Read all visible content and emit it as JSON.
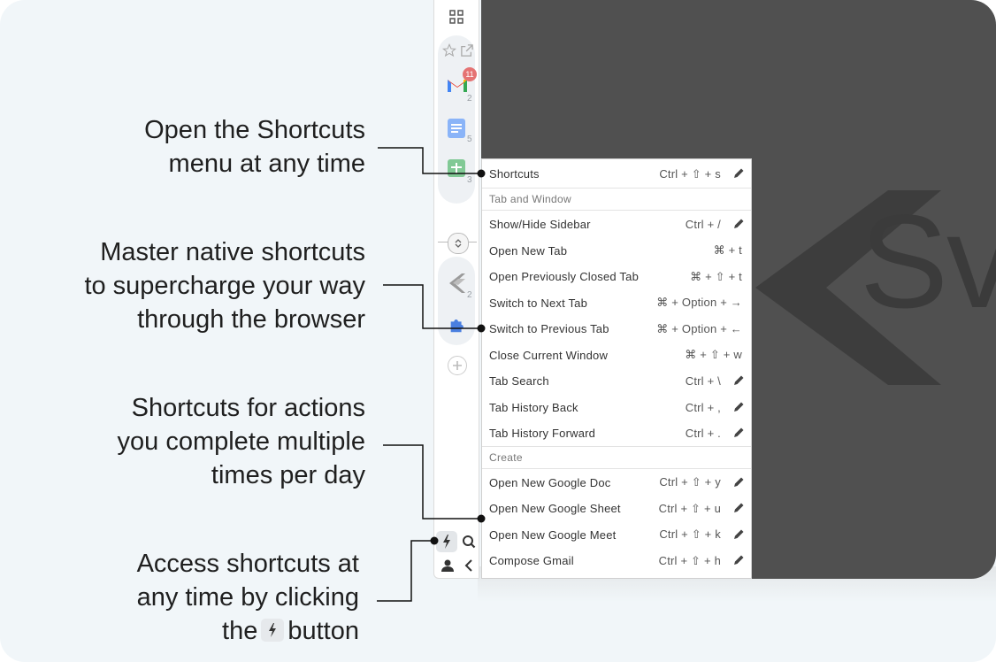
{
  "callouts": [
    {
      "lines": [
        "Open the Shortcuts",
        "menu at any time"
      ]
    },
    {
      "lines": [
        "Master native shortcuts",
        "to supercharge your way",
        "through the browser"
      ]
    },
    {
      "lines": [
        "Shortcuts for actions",
        "you complete multiple",
        "times per day"
      ]
    },
    {
      "lines_before": [
        "Access shortcuts at",
        "any time by clicking"
      ],
      "last_before": "the",
      "last_after": "button"
    }
  ],
  "sidebar": {
    "gmail_badge": "11",
    "gmail_count": "2",
    "docs_count": "5",
    "sheets_count": "3",
    "shift_count": "2"
  },
  "watermark": "Sv",
  "panel": {
    "header": {
      "name": "Shortcuts",
      "keys": "Ctrl + ⇧ + s"
    },
    "sections": [
      {
        "title": "Tab and Window",
        "rows": [
          {
            "name": "Show/Hide Sidebar",
            "keys": "Ctrl + /",
            "editable": true
          },
          {
            "name": "Open New Tab",
            "keys": "⌘ + t",
            "editable": false
          },
          {
            "name": "Open Previously Closed Tab",
            "keys": "⌘ + ⇧ + t",
            "editable": false
          },
          {
            "name": "Switch to Next Tab",
            "keys": "⌘ + Option + →",
            "editable": false
          },
          {
            "name": "Switch to Previous Tab",
            "keys": "⌘ + Option + ←",
            "editable": false
          },
          {
            "name": "Close Current Window",
            "keys": "⌘ + ⇧ + w",
            "editable": false
          },
          {
            "name": "Tab Search",
            "keys": "Ctrl + \\",
            "editable": true
          },
          {
            "name": "Tab History Back",
            "keys": "Ctrl + ,",
            "editable": true
          },
          {
            "name": "Tab History Forward",
            "keys": "Ctrl + .",
            "editable": true
          }
        ]
      },
      {
        "title": "Create",
        "rows": [
          {
            "name": "Open New Google Doc",
            "keys": "Ctrl + ⇧ + y",
            "editable": true
          },
          {
            "name": "Open New Google Sheet",
            "keys": "Ctrl + ⇧ + u",
            "editable": true
          },
          {
            "name": "Open New Google Meet",
            "keys": "Ctrl + ⇧ + k",
            "editable": true
          },
          {
            "name": "Compose Gmail",
            "keys": "Ctrl + ⇧ + h",
            "editable": true
          }
        ]
      }
    ]
  }
}
